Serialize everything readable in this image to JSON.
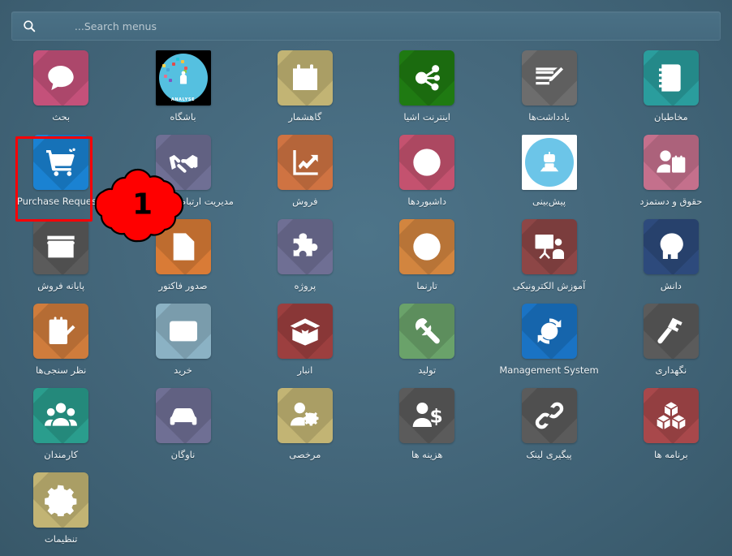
{
  "search": {
    "placeholder": "Search menus...",
    "value": "",
    "icon": "search-icon"
  },
  "annotation": {
    "marker_number": "1",
    "highlight_color": "#fb0007",
    "marker_fill": "#ff0000",
    "highlighted_item": "حقوق و دستمزد"
  },
  "theme": {
    "background": "#45687c",
    "label_color": "#eef3f6"
  },
  "grid": {
    "columns": 6,
    "items": [
      {
        "label": "مخاطبان",
        "icon": "contacts-icon",
        "color": "#2a9d9d",
        "latin": false
      },
      {
        "label": "یادداشت‌ها",
        "icon": "notes-edit-icon",
        "color": "#6d6d6d",
        "latin": false
      },
      {
        "label": "اینترنت اشیا",
        "icon": "iot-share-icon",
        "color": "#1f7a12",
        "latin": false
      },
      {
        "label": "گاهشمار",
        "icon": "calendar-icon",
        "color": "#c2b474",
        "latin": false
      },
      {
        "label": "باشگاه",
        "icon": "club-analysis-photo-icon",
        "color": "#000000",
        "latin": false
      },
      {
        "label": "بحث",
        "icon": "chat-bubble-icon",
        "color": "#c4517a",
        "latin": false
      },
      {
        "label": "حقوق و دستمزد",
        "icon": "payroll-user-money-icon",
        "color": "#c4708c",
        "latin": false
      },
      {
        "label": "پیش‌بینی",
        "icon": "robot-forecast-photo-icon",
        "color": "#ffffff",
        "latin": false
      },
      {
        "label": "داشبوردها",
        "icon": "dashboard-gauge-icon",
        "color": "#c4526f",
        "latin": false
      },
      {
        "label": "فروش",
        "icon": "sales-chart-up-icon",
        "color": "#cf7342",
        "latin": false
      },
      {
        "label": "مدیریت ارتباط با مشتریان",
        "icon": "handshake-crm-icon",
        "color": "#6f6f94",
        "latin": false
      },
      {
        "label": "Purchase Requests",
        "icon": "shopping-cart-icon",
        "color": "#1a82d2",
        "latin": true
      },
      {
        "label": "دانش",
        "icon": "brain-gears-icon",
        "color": "#2d4a7c",
        "latin": false
      },
      {
        "label": "آموزش الکترونیکی",
        "icon": "elearning-board-icon",
        "color": "#8d4646",
        "latin": false
      },
      {
        "label": "تارنما",
        "icon": "globe-website-icon",
        "color": "#d2853f",
        "latin": false
      },
      {
        "label": "پروژه",
        "icon": "puzzle-project-icon",
        "color": "#6f6f94",
        "latin": false
      },
      {
        "label": "صدور فاکتور",
        "icon": "invoice-doc-icon",
        "color": "#d97b36",
        "latin": false
      },
      {
        "label": "پایانه فروش",
        "icon": "storefront-pos-icon",
        "color": "#5b5b5b",
        "latin": false
      },
      {
        "label": "نگهداری",
        "icon": "hammer-maintenance-icon",
        "color": "#5b5b5b",
        "latin": false
      },
      {
        "label": "Management System",
        "icon": "check-cycle-icon",
        "color": "#1a73c4",
        "latin": true
      },
      {
        "label": "تولید",
        "icon": "wrench-manufacturing-icon",
        "color": "#6aa26a",
        "latin": false
      },
      {
        "label": "انبار",
        "icon": "open-box-inventory-icon",
        "color": "#9c3f3f",
        "latin": false
      },
      {
        "label": "خرید",
        "icon": "credit-card-purchase-icon",
        "color": "#8bb2c4",
        "latin": false
      },
      {
        "label": "نظر سنجی‌ها",
        "icon": "clipboard-survey-icon",
        "color": "#cf7c3c",
        "latin": false
      },
      {
        "label": "برنامه ها",
        "icon": "cubes-apps-icon",
        "color": "#a8484b",
        "latin": false
      },
      {
        "label": "پیگیری لینک",
        "icon": "link-chain-icon",
        "color": "#5b5b5b",
        "latin": false
      },
      {
        "label": "هزینه ها",
        "icon": "user-expense-icon",
        "color": "#5b5b5b",
        "latin": false
      },
      {
        "label": "مرخصی",
        "icon": "user-gear-leave-icon",
        "color": "#c2b474",
        "latin": false
      },
      {
        "label": "ناوگان",
        "icon": "car-fleet-icon",
        "color": "#6f6f94",
        "latin": false
      },
      {
        "label": "کارمندان",
        "icon": "employees-group-icon",
        "color": "#2a9d8d",
        "latin": false
      },
      {
        "label": "",
        "icon": "",
        "color": "",
        "latin": false
      },
      {
        "label": "",
        "icon": "",
        "color": "",
        "latin": false
      },
      {
        "label": "",
        "icon": "",
        "color": "",
        "latin": false
      },
      {
        "label": "",
        "icon": "",
        "color": "",
        "latin": false
      },
      {
        "label": "",
        "icon": "",
        "color": "",
        "latin": false
      },
      {
        "label": "تنظیمات",
        "icon": "gear-settings-icon",
        "color": "#c2b474",
        "latin": false
      }
    ]
  }
}
